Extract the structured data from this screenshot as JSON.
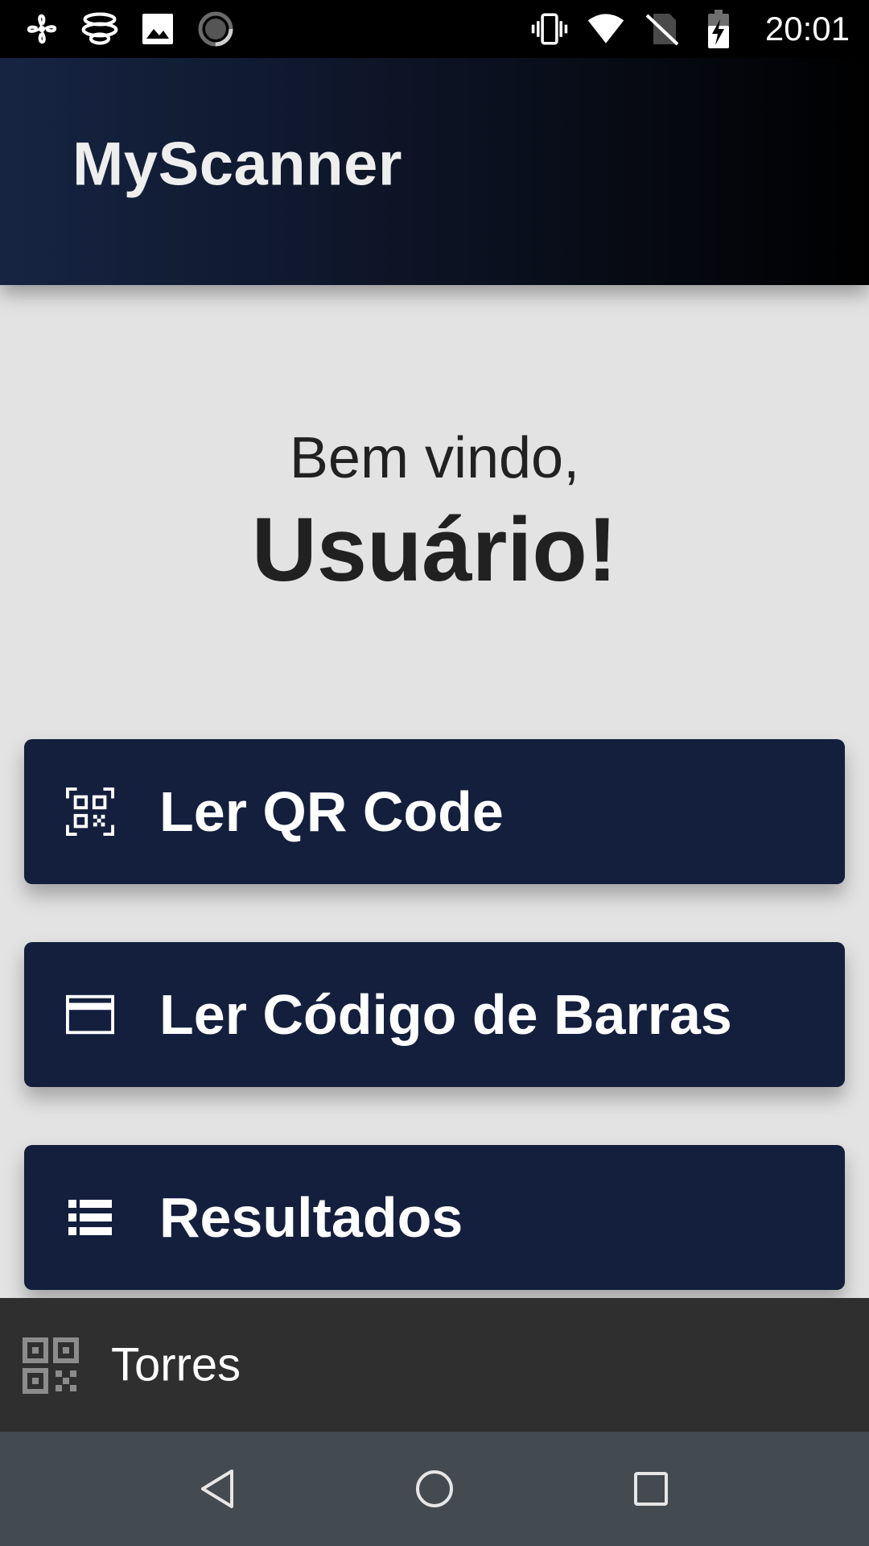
{
  "status_bar": {
    "time": "20:01",
    "left_icons": [
      "fan-icon",
      "wifi-calling-icon",
      "image-icon",
      "loading-icon"
    ],
    "right_icons": [
      "vibrate-icon",
      "wifi-icon",
      "no-sim-icon",
      "battery-charging-icon"
    ]
  },
  "app_bar": {
    "title": "MyScanner"
  },
  "welcome": {
    "greeting": "Bem vindo,",
    "user": "Usuário!"
  },
  "actions": [
    {
      "label": "Ler QR Code",
      "icon": "qr-scan-icon"
    },
    {
      "label": "Ler Código de Barras",
      "icon": "card-icon"
    },
    {
      "label": "Resultados",
      "icon": "list-icon"
    }
  ],
  "bottom_item": {
    "label": "Torres",
    "icon": "qr-code-icon"
  },
  "nav_bar": {
    "buttons": [
      "back-icon",
      "home-icon",
      "recents-icon"
    ]
  },
  "colors": {
    "status_bar_bg": "#000000",
    "app_bar_gradient_start": "#162443",
    "app_bar_gradient_end": "#000000",
    "background": "#e3e3e3",
    "button_bg": "#141f3e",
    "button_text": "#ffffff",
    "bottom_item_bg": "#2f2f2f",
    "nav_bar_bg": "#434a50"
  }
}
